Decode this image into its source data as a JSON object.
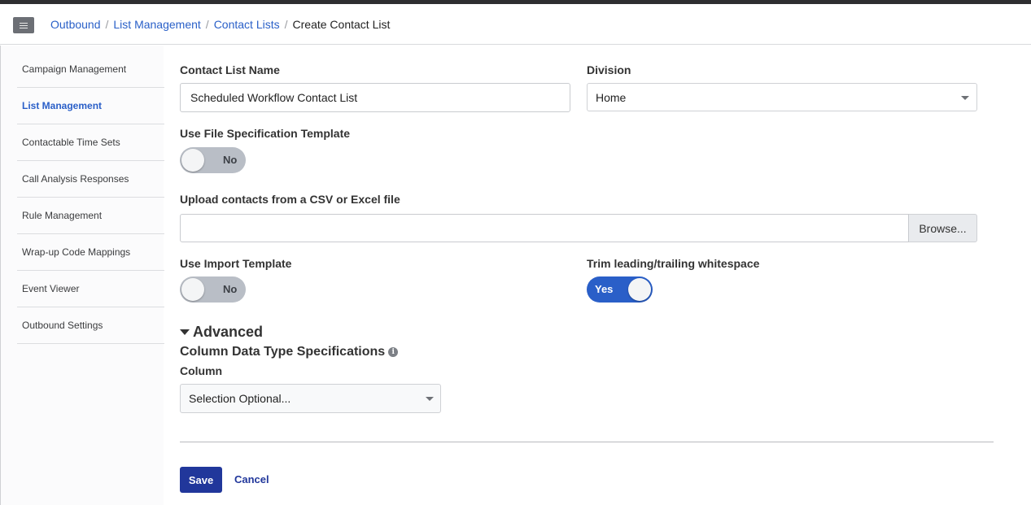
{
  "breadcrumb": {
    "items": [
      "Outbound",
      "List Management",
      "Contact Lists"
    ],
    "current": "Create Contact List",
    "separator": "/"
  },
  "sidebar": {
    "items": [
      {
        "label": "Campaign Management",
        "active": false
      },
      {
        "label": "List Management",
        "active": true
      },
      {
        "label": "Contactable Time Sets",
        "active": false
      },
      {
        "label": "Call Analysis Responses",
        "active": false
      },
      {
        "label": "Rule Management",
        "active": false
      },
      {
        "label": "Wrap-up Code Mappings",
        "active": false
      },
      {
        "label": "Event Viewer",
        "active": false
      },
      {
        "label": "Outbound Settings",
        "active": false
      }
    ]
  },
  "form": {
    "contact_list_name": {
      "label": "Contact List Name",
      "value": "Scheduled Workflow Contact List"
    },
    "division": {
      "label": "Division",
      "value": "Home"
    },
    "file_spec_template": {
      "label": "Use File Specification Template",
      "state": "No"
    },
    "upload": {
      "label": "Upload contacts from a CSV or Excel file",
      "value": "",
      "browse_label": "Browse..."
    },
    "import_template": {
      "label": "Use Import Template",
      "state": "No"
    },
    "trim_whitespace": {
      "label": "Trim leading/trailing whitespace",
      "state": "Yes"
    },
    "advanced": {
      "label": "Advanced"
    },
    "column_spec": {
      "label": "Column Data Type Specifications",
      "info_glyph": "i"
    },
    "column": {
      "label": "Column",
      "value": "Selection Optional..."
    }
  },
  "actions": {
    "save_label": "Save",
    "cancel_label": "Cancel"
  },
  "colors": {
    "accent": "#2a5fc8",
    "primary_button": "#21379b",
    "toggle_off": "#b9bec6"
  },
  "icons": [
    "menu-icon",
    "chevron-down-icon",
    "caret-down-icon",
    "info-icon"
  ]
}
